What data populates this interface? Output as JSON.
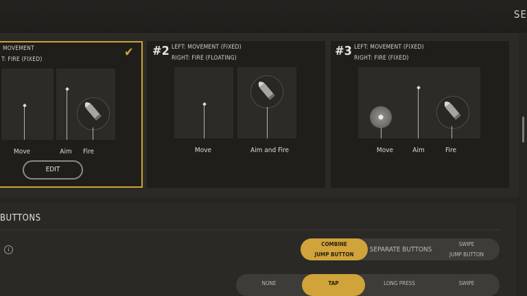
{
  "header": {
    "corner_title": "SE"
  },
  "cards": [
    {
      "number": "",
      "line1": "MOVEMENT",
      "line2": "T: FIRE (FIXED)",
      "labels": [
        "Move",
        "Aim",
        "Fire"
      ],
      "edit_label": "EDIT"
    },
    {
      "number": "#2",
      "line1": "LEFT: MOVEMENT (FIXED)",
      "line2": "RIGHT: FIRE (FLOATING)",
      "labels": [
        "Move",
        "Aim and Fire"
      ]
    },
    {
      "number": "#3",
      "line1": "LEFT: MOVEMENT (FIXED)",
      "line2": "RIGHT: FIRE (FIXED)",
      "labels": [
        "Move",
        "Aim",
        "Fire"
      ]
    }
  ],
  "section": {
    "title": "BUTTONS",
    "jump_options": [
      "COMBINE",
      "JUMP BUTTON",
      "SEPARATE BUTTONS",
      "SWIPE",
      "JUMP BUTTON"
    ],
    "row2_options": [
      "NONE",
      "TAP",
      "LONG PRESS",
      "SWIPE"
    ]
  },
  "colors": {
    "accent": "#d0a43b",
    "card_bg": "#1f1e1b",
    "page_bg": "#262522"
  }
}
